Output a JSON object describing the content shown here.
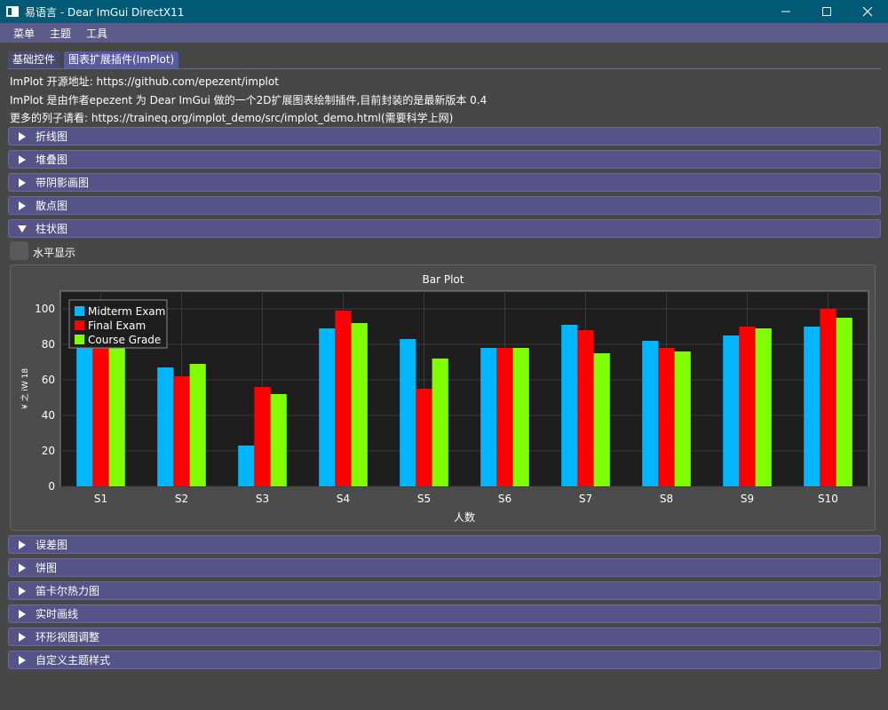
{
  "window": {
    "title": "易语言 - Dear ImGui DirectX11",
    "minimize": "—",
    "maximize": "☐",
    "close": "✕"
  },
  "menu": [
    "菜单",
    "主题",
    "工具"
  ],
  "tabs": [
    {
      "label": "基础控件",
      "active": false
    },
    {
      "label": "图表扩展插件(ImPlot)",
      "active": true
    }
  ],
  "info_lines": [
    "ImPlot 开源地址: https://github.com/epezent/implot",
    "ImPlot 是由作者epezent 为 Dear ImGui 做的一个2D扩展图表绘制插件,目前封装的是最新版本 0.4",
    "更多的列子请看: https://traineq.org/implot_demo/src/implot_demo.html(需要科学上网)"
  ],
  "sections_top": [
    {
      "label": "折线图",
      "open": false
    },
    {
      "label": "堆叠图",
      "open": false
    },
    {
      "label": "带阴影画图",
      "open": false
    },
    {
      "label": "散点图",
      "open": false
    },
    {
      "label": "柱状图",
      "open": true
    }
  ],
  "checkbox": {
    "label": "水平显示",
    "checked": false
  },
  "sections_bottom": [
    {
      "label": "误差图",
      "open": false
    },
    {
      "label": "饼图",
      "open": false
    },
    {
      "label": "笛卡尔热力图",
      "open": false
    },
    {
      "label": "实时画线",
      "open": false
    },
    {
      "label": "环形视图调整",
      "open": false
    },
    {
      "label": "自定义主题样式",
      "open": false
    }
  ],
  "chart_data": {
    "type": "bar",
    "title": "Bar Plot",
    "xlabel": "人数",
    "ylabel": "¥ 之 iW 18",
    "categories": [
      "S1",
      "S2",
      "S3",
      "S4",
      "S5",
      "S6",
      "S7",
      "S8",
      "S9",
      "S10"
    ],
    "ylim": [
      0,
      110
    ],
    "yticks": [
      0,
      20,
      40,
      60,
      80,
      100
    ],
    "grid": true,
    "legend_position": "top-left",
    "series": [
      {
        "name": "Midterm Exam",
        "color": "#00b7ff",
        "values": [
          83,
          67,
          23,
          89,
          83,
          78,
          91,
          82,
          85,
          90
        ]
      },
      {
        "name": "Final Exam",
        "color": "#ff0000",
        "values": [
          80,
          62,
          56,
          99,
          55,
          78,
          88,
          78,
          90,
          100
        ]
      },
      {
        "name": "Course Grade",
        "color": "#80ff00",
        "values": [
          80,
          69,
          52,
          92,
          72,
          78,
          75,
          76,
          89,
          95
        ]
      }
    ]
  }
}
